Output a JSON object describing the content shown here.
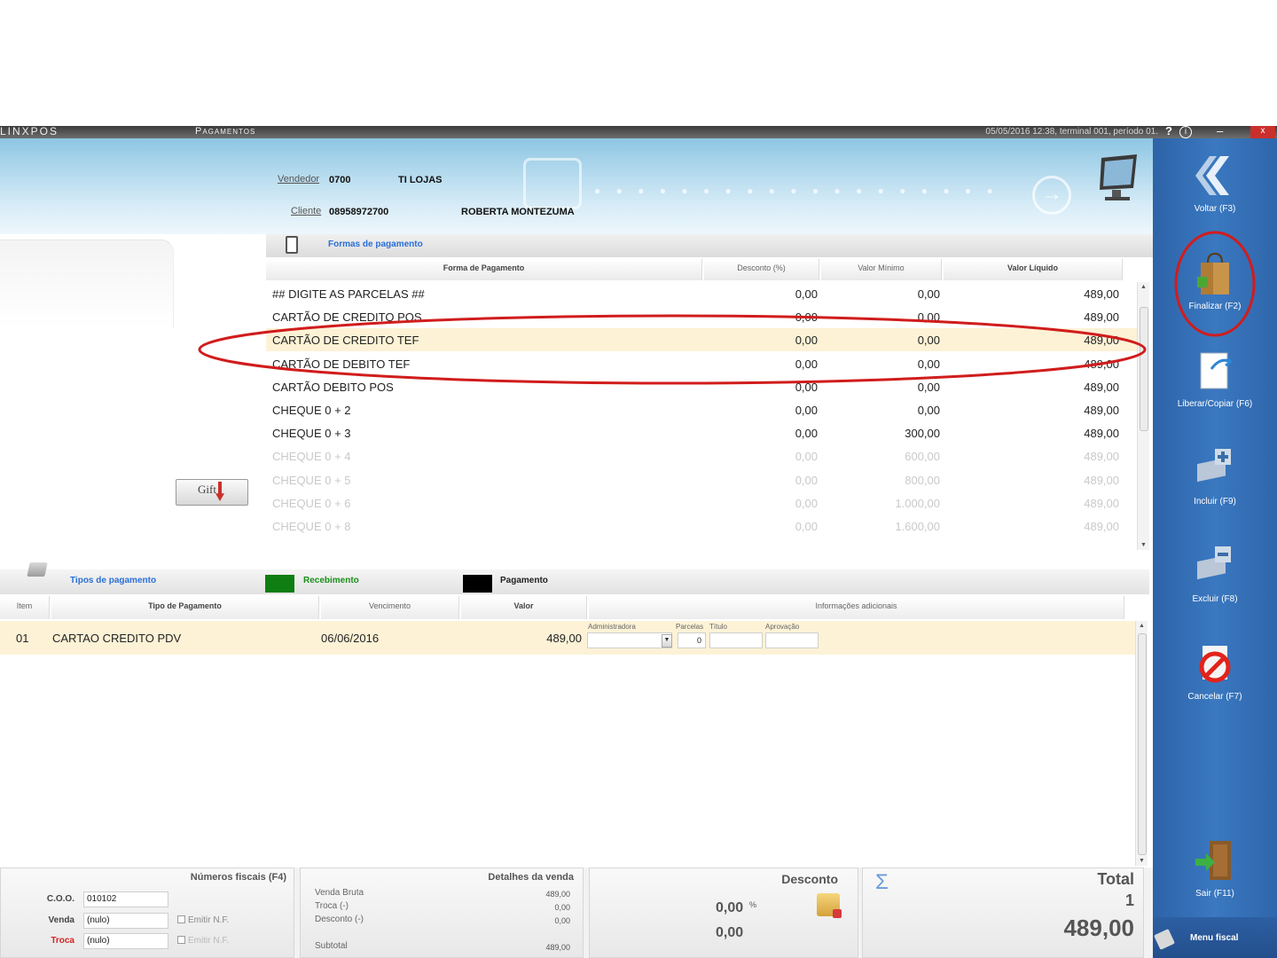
{
  "titlebar": {
    "logo": "LINXPOS",
    "window_title": "Pagamentos",
    "session": "05/05/2016 12:38, terminal 001, período 01.",
    "help": "?",
    "info": "i",
    "minimize": "–",
    "close": "x"
  },
  "header": {
    "vendedor_label": "Vendedor",
    "vendedor_code": "0700",
    "vendedor_name": "TI LOJAS",
    "cliente_label": "Cliente",
    "cliente_code": "08958972700",
    "cliente_name": "ROBERTA MONTEZUMA"
  },
  "gift_button_label": "Gift",
  "formas": {
    "section_title": "Formas de pagamento",
    "columns": {
      "forma": "Forma de Pagamento",
      "desconto": "Desconto (%)",
      "minimo": "Valor Mínimo",
      "liquido": "Valor Líquido"
    },
    "rows": [
      {
        "name": "## DIGITE AS PARCELAS ##",
        "desconto": "0,00",
        "minimo": "0,00",
        "liquido": "489,00"
      },
      {
        "name": "CARTÃO DE CREDITO POS",
        "desconto": "0,00",
        "minimo": "0,00",
        "liquido": "489,00"
      },
      {
        "name": "CARTÃO DE CREDITO TEF",
        "desconto": "0,00",
        "minimo": "0,00",
        "liquido": "489,00"
      },
      {
        "name": "CARTÃO DE DEBITO TEF",
        "desconto": "0,00",
        "minimo": "0,00",
        "liquido": "489,00"
      },
      {
        "name": "CARTÃO DEBITO POS",
        "desconto": "0,00",
        "minimo": "0,00",
        "liquido": "489,00"
      },
      {
        "name": "CHEQUE 0 + 2",
        "desconto": "0,00",
        "minimo": "0,00",
        "liquido": "489,00"
      },
      {
        "name": "CHEQUE 0 + 3",
        "desconto": "0,00",
        "minimo": "300,00",
        "liquido": "489,00"
      },
      {
        "name": "CHEQUE 0 + 4",
        "desconto": "0,00",
        "minimo": "600,00",
        "liquido": "489,00"
      },
      {
        "name": "CHEQUE 0 + 5",
        "desconto": "0,00",
        "minimo": "800,00",
        "liquido": "489,00"
      },
      {
        "name": "CHEQUE 0 + 6",
        "desconto": "0,00",
        "minimo": "1.000,00",
        "liquido": "489,00"
      },
      {
        "name": "CHEQUE 0 + 8",
        "desconto": "0,00",
        "minimo": "1.600,00",
        "liquido": "489,00"
      }
    ]
  },
  "tipos": {
    "section_title": "Tipos de pagamento",
    "legend_recebimento": "Recebimento",
    "legend_pagamento": "Pagamento",
    "columns": {
      "item": "Item",
      "tipo": "Tipo de Pagamento",
      "vencimento": "Vencimento",
      "valor": "Valor",
      "info": "Informações adicionais"
    },
    "row": {
      "item": "01",
      "tipo": "CARTAO CREDITO PDV",
      "vencimento": "06/06/2016",
      "valor": "489,00",
      "administradora_label": "Administradora",
      "parcelas_label": "Parcelas",
      "parcelas_value": "0",
      "titulo_label": "Título",
      "aprovacao_label": "Aprovação"
    }
  },
  "fiscais": {
    "title": "Números fiscais (F4)",
    "coo_label": "C.O.O.",
    "coo_value": "010102",
    "venda_label": "Venda",
    "venda_value": "(nulo)",
    "troca_label": "Troca",
    "troca_value": "(nulo)",
    "emitir_nf": "Emitir N.F."
  },
  "detalhes": {
    "title": "Detalhes da venda",
    "venda_bruta_label": "Venda Bruta",
    "venda_bruta": "489,00",
    "troca_label": "Troca (-)",
    "troca": "0,00",
    "desconto_label": "Desconto (-)",
    "desconto": "0,00",
    "subtotal_label": "Subtotal",
    "subtotal": "489,00"
  },
  "desconto_panel": {
    "title": "Desconto",
    "percent": "0,00",
    "percent_sign": "%",
    "value": "0,00"
  },
  "total_panel": {
    "sigma": "Σ",
    "title": "Total",
    "count": "1",
    "value": "489,00"
  },
  "sidebar": {
    "voltar": "Voltar (F3)",
    "finalizar": "Finalizar (F2)",
    "liberar": "Liberar/Copiar (F6)",
    "incluir": "Incluir (F9)",
    "excluir": "Excluir (F8)",
    "cancelar": "Cancelar (F7)",
    "sair": "Sair (F11)",
    "menu_fiscal": "Menu fiscal"
  },
  "colors": {
    "sidebar_blue": "#3a78c0",
    "selected_row": "#fdf2d6",
    "legend_recebimento": "#0e7d12",
    "legend_pagamento": "#000000",
    "annotation_red": "#d11c1c",
    "section_title_blue": "#2a6fd6"
  }
}
